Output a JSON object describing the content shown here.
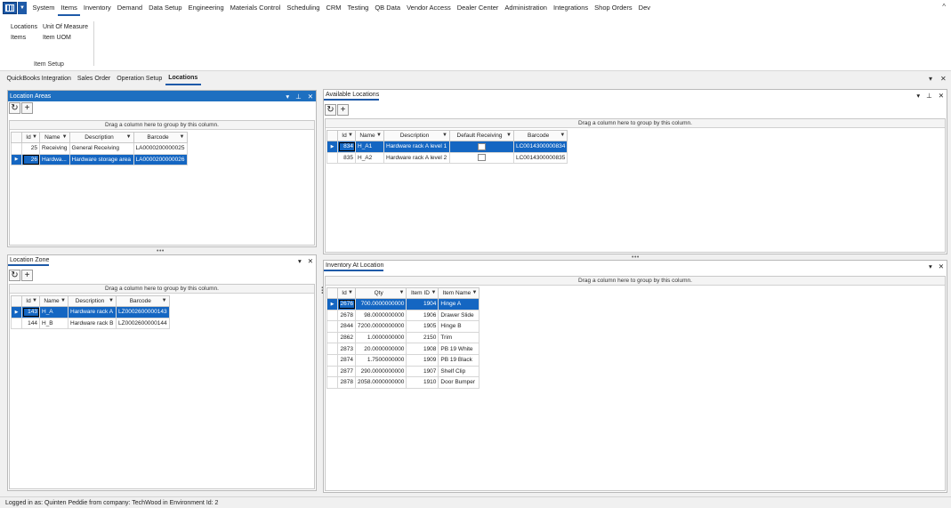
{
  "menu": {
    "items": [
      "System",
      "Items",
      "Inventory",
      "Demand",
      "Data Setup",
      "Engineering",
      "Materials Control",
      "Scheduling",
      "CRM",
      "Testing",
      "QB Data",
      "Vendor Access",
      "Dealer Center",
      "Administration",
      "Integrations",
      "Shop Orders",
      "Dev"
    ],
    "active": "Items",
    "collapse_icon": "^"
  },
  "ribbon": {
    "links": [
      "Locations",
      "Unit Of Measure",
      "Items",
      "Item UOM"
    ],
    "group_label": "Item Setup"
  },
  "doc_tabs": {
    "items": [
      "QuickBooks Integration",
      "Sales Order",
      "Operation Setup",
      "Locations"
    ],
    "active": "Locations",
    "dropdown_icon": "▾",
    "close_icon": "✕"
  },
  "controls": {
    "menu": "▾",
    "pin": "⊥",
    "close": "✕",
    "refresh": "↻",
    "add": "+",
    "filter": "▼",
    "row_indicator": "▶",
    "splitter": "•••"
  },
  "group_hint": "Drag a column here to group by this column.",
  "location_areas": {
    "title": "Location Areas",
    "columns": [
      "Id",
      "Name",
      "Description",
      "Barcode"
    ],
    "rows": [
      {
        "id": "25",
        "name": "Receiving",
        "description": "General Receiving",
        "barcode": "LA0000200000025"
      },
      {
        "id": "26",
        "name": "Hardwa...",
        "description": "Hardware storage area",
        "barcode": "LA0000200000026"
      }
    ],
    "selected_index": 1
  },
  "location_zone": {
    "title": "Location Zone",
    "columns": [
      "Id",
      "Name",
      "Description",
      "Barcode"
    ],
    "rows": [
      {
        "id": "143",
        "name": "H_A",
        "description": "Hardware rack A",
        "barcode": "LZ0002600000143"
      },
      {
        "id": "144",
        "name": "H_B",
        "description": "Hardware rack B",
        "barcode": "LZ0002600000144"
      }
    ],
    "selected_index": 0
  },
  "available_locations": {
    "title": "Available Locations",
    "columns": [
      "Id",
      "Name",
      "Description",
      "Default Receiving",
      "Barcode"
    ],
    "rows": [
      {
        "id": "834",
        "name": "H_A1",
        "description": "Hardware rack A level 1",
        "barcode": "LC0014300000834"
      },
      {
        "id": "835",
        "name": "H_A2",
        "description": "Hardware rack A level 2",
        "barcode": "LC0014300000835"
      }
    ],
    "selected_index": 0
  },
  "inventory_at_location": {
    "title": "Inventory At Location",
    "columns": [
      "Id",
      "Qty",
      "Item ID",
      "Item Name"
    ],
    "rows": [
      {
        "id": "2676",
        "qty": "700.0000000000",
        "item_id": "1904",
        "item_name": "Hinge A"
      },
      {
        "id": "2678",
        "qty": "98.0000000000",
        "item_id": "1906",
        "item_name": "Drawer Slide"
      },
      {
        "id": "2844",
        "qty": "7200.0000000000",
        "item_id": "1905",
        "item_name": "Hinge B"
      },
      {
        "id": "2862",
        "qty": "1.0000000000",
        "item_id": "2150",
        "item_name": "Trim"
      },
      {
        "id": "2873",
        "qty": "20.0000000000",
        "item_id": "1908",
        "item_name": "PB 19 White"
      },
      {
        "id": "2874",
        "qty": "1.7500000000",
        "item_id": "1909",
        "item_name": "PB 19 Black"
      },
      {
        "id": "2877",
        "qty": "290.0000000000",
        "item_id": "1907",
        "item_name": "Shelf Clip"
      },
      {
        "id": "2878",
        "qty": "2058.0000000000",
        "item_id": "1910",
        "item_name": "Door Bumper"
      }
    ],
    "selected_index": 0
  },
  "status": {
    "text": "Logged in as: Quinten Peddie  from company: TechWood in Environment Id: 2"
  },
  "colors": {
    "accent": "#1e5aa8",
    "selection": "#1466c2",
    "panel_header_active": "#1e6fc0"
  }
}
